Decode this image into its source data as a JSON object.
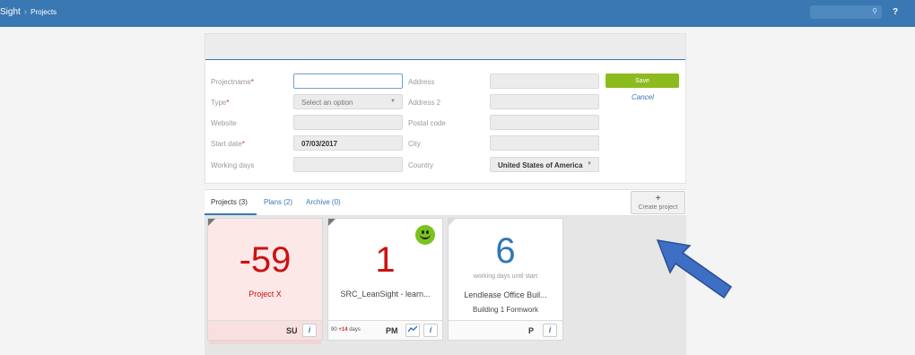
{
  "topbar": {
    "brand": "Sight",
    "breadcrumb": "Projects",
    "help": "?"
  },
  "form": {
    "projectname_label": "Projectname",
    "type_label": "Type",
    "type_placeholder": "Select an option",
    "website_label": "Website",
    "start_date_label": "Start date",
    "start_date_value": "07/03/2017",
    "working_days_label": "Working days",
    "address_label": "Address",
    "address2_label": "Address 2",
    "postal_code_label": "Postal code",
    "city_label": "City",
    "country_label": "Country",
    "country_value": "United States of America",
    "save_label": "Save",
    "cancel_label": "Cancel",
    "required_mark": "*"
  },
  "tabs": [
    {
      "label": "Projects (3)"
    },
    {
      "label": "Plans (2)"
    },
    {
      "label": "Archive (0)"
    }
  ],
  "create_project": {
    "plus": "+",
    "label": "Create project"
  },
  "cards": [
    {
      "number": "-59",
      "number_color": "#cc1111",
      "title": "Project X",
      "initials": "SU",
      "info": "i"
    },
    {
      "number": "1",
      "number_color": "#cc1111",
      "title": "SRC_LeanSight - learn...",
      "initials": "PM",
      "info": "i",
      "days_base": "90",
      "days_plus": "+14",
      "days_unit": "days",
      "trend_icon": "trend-icon"
    },
    {
      "number": "6",
      "number_color": "#2f78b4",
      "subtitle": "working days until start",
      "title": "Lendlease Office Buil...",
      "title2": "Building 1 Formwork",
      "initials": "P",
      "info": "i"
    }
  ],
  "colors": {
    "topbar": "#3a78b3",
    "save": "#8cbb1e",
    "accent": "#3a78b3",
    "arrow": "#3d6fc4"
  }
}
